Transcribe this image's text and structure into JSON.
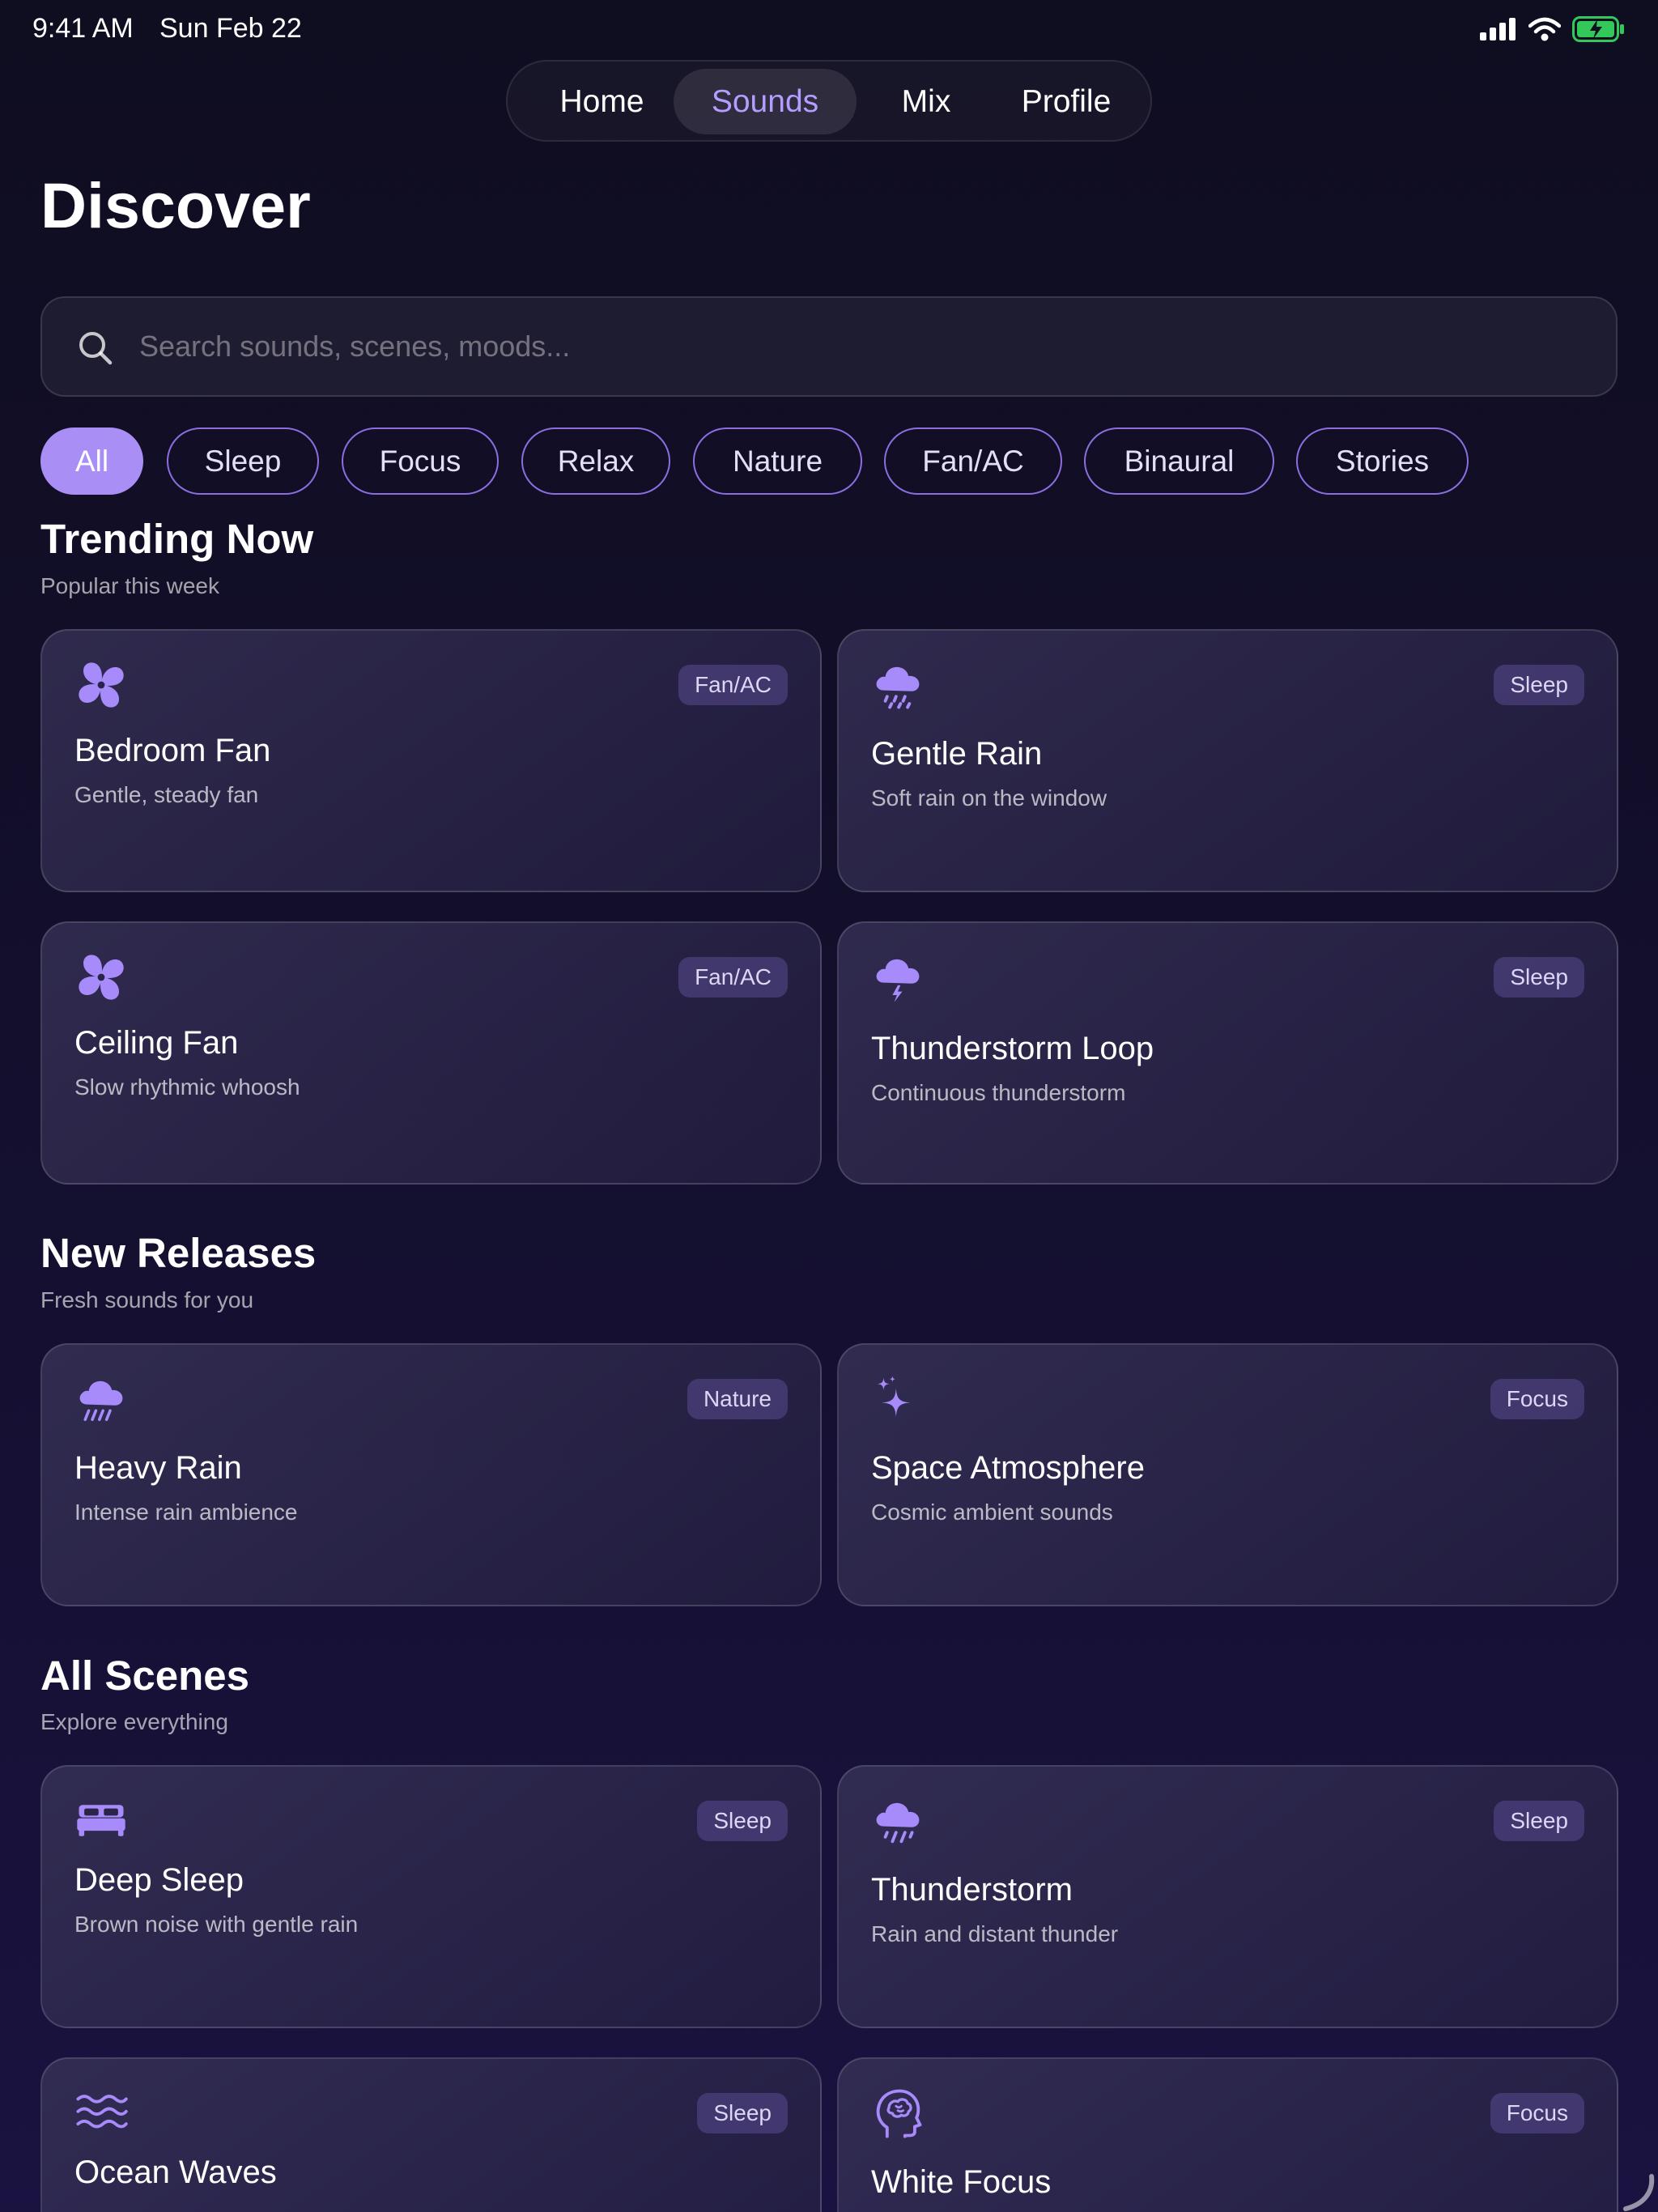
{
  "status": {
    "time": "9:41 AM",
    "date": "Sun Feb 22"
  },
  "nav": {
    "tabs": [
      {
        "label": "Home",
        "active": false
      },
      {
        "label": "Sounds",
        "active": true
      },
      {
        "label": "Mix",
        "active": false
      },
      {
        "label": "Profile",
        "active": false
      }
    ]
  },
  "page": {
    "title": "Discover"
  },
  "search": {
    "placeholder": "Search sounds, scenes, moods..."
  },
  "filters": [
    "All",
    "Sleep",
    "Focus",
    "Relax",
    "Nature",
    "Fan/AC",
    "Binaural",
    "Stories"
  ],
  "active_filter": "All",
  "sections": [
    {
      "title": "Trending Now",
      "subtitle": "Popular this week",
      "cards": [
        {
          "icon": "fan-icon",
          "badge": "Fan/AC",
          "title": "Bedroom Fan",
          "subtitle": "Gentle, steady fan"
        },
        {
          "icon": "rain-cloud-icon",
          "badge": "Sleep",
          "title": "Gentle Rain",
          "subtitle": "Soft rain on the window"
        },
        {
          "icon": "fan-icon",
          "badge": "Fan/AC",
          "title": "Ceiling Fan",
          "subtitle": "Slow rhythmic whoosh"
        },
        {
          "icon": "thunder-cloud-icon",
          "badge": "Sleep",
          "title": "Thunderstorm Loop",
          "subtitle": "Continuous thunderstorm"
        }
      ]
    },
    {
      "title": "New Releases",
      "subtitle": "Fresh sounds for you",
      "cards": [
        {
          "icon": "heavy-rain-icon",
          "badge": "Nature",
          "title": "Heavy Rain",
          "subtitle": "Intense rain ambience"
        },
        {
          "icon": "sparkles-icon",
          "badge": "Focus",
          "title": "Space Atmosphere",
          "subtitle": "Cosmic ambient sounds"
        }
      ]
    },
    {
      "title": "All Scenes",
      "subtitle": "Explore everything",
      "cards": [
        {
          "icon": "bed-icon",
          "badge": "Sleep",
          "title": "Deep Sleep",
          "subtitle": "Brown noise with gentle rain"
        },
        {
          "icon": "rain-cloud-icon",
          "badge": "Sleep",
          "title": "Thunderstorm",
          "subtitle": "Rain and distant thunder"
        },
        {
          "icon": "waves-icon",
          "badge": "Sleep",
          "title": "Ocean Waves",
          "subtitle": ""
        },
        {
          "icon": "brain-head-icon",
          "badge": "Focus",
          "title": "White Focus",
          "subtitle": ""
        }
      ]
    }
  ],
  "colors": {
    "accent": "#a98ef6",
    "background": "#120f2a",
    "icon": "#a78bfa",
    "battery": "#34c759"
  }
}
